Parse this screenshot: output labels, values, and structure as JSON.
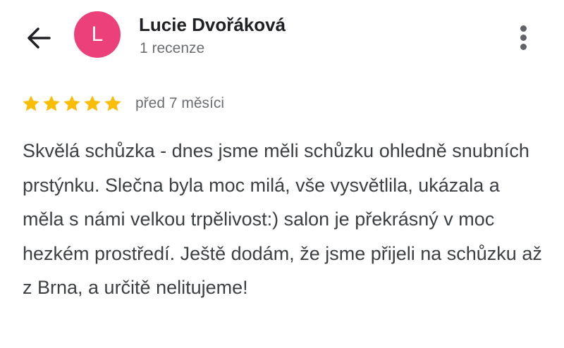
{
  "header": {
    "back_icon": "arrow-back-icon",
    "avatar_letter": "L",
    "avatar_color": "#ec407a",
    "user_name": "Lucie Dvořáková",
    "review_count": "1 recenze",
    "more_icon": "more-vert-icon"
  },
  "review": {
    "rating": 5,
    "rating_max": 5,
    "star_color": "#fbbc04",
    "date": "před 7 měsíci",
    "text": "Skvělá schůzka - dnes jsme měli schůzku ohledně snubních prstýnku. Slečna byla moc milá, vše vysvětlila, ukázala a měla s námi velkou trpělivost:) salon je překrásný v moc hezkém prostředí. Ještě dodám, že jsme přijeli na schůzku až z Brna, a určitě nelitujeme!"
  }
}
